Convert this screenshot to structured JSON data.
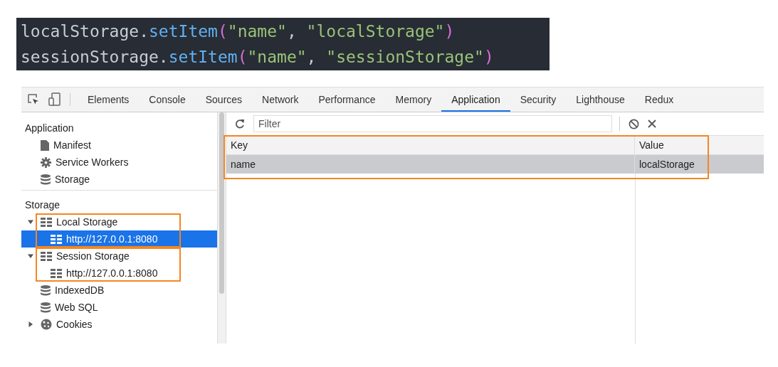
{
  "code_lines": [
    [
      {
        "kind": "plain",
        "text": "localStorage."
      },
      {
        "kind": "method",
        "text": "setItem"
      },
      {
        "kind": "paren",
        "text": "("
      },
      {
        "kind": "string",
        "text": "\"name\""
      },
      {
        "kind": "plain",
        "text": ", "
      },
      {
        "kind": "string",
        "text": "\"localStorage\""
      },
      {
        "kind": "paren",
        "text": ")"
      }
    ],
    [
      {
        "kind": "plain",
        "text": "sessionStorage."
      },
      {
        "kind": "method",
        "text": "setItem"
      },
      {
        "kind": "paren",
        "text": "("
      },
      {
        "kind": "string",
        "text": "\"name\""
      },
      {
        "kind": "plain",
        "text": ", "
      },
      {
        "kind": "string",
        "text": "\"sessionStorage\""
      },
      {
        "kind": "paren",
        "text": ")"
      }
    ]
  ],
  "tabs": [
    {
      "label": "Elements",
      "selected": false
    },
    {
      "label": "Console",
      "selected": false
    },
    {
      "label": "Sources",
      "selected": false
    },
    {
      "label": "Network",
      "selected": false
    },
    {
      "label": "Performance",
      "selected": false
    },
    {
      "label": "Memory",
      "selected": false
    },
    {
      "label": "Application",
      "selected": true
    },
    {
      "label": "Security",
      "selected": false
    },
    {
      "label": "Lighthouse",
      "selected": false
    },
    {
      "label": "Redux",
      "selected": false
    }
  ],
  "sidebar": {
    "sections": [
      {
        "title": "Application",
        "items": [
          {
            "label": "Manifest",
            "kind": "file"
          },
          {
            "label": "Service Workers",
            "kind": "gear"
          },
          {
            "label": "Storage",
            "kind": "database"
          }
        ]
      },
      {
        "title": "Storage",
        "items": [
          {
            "label": "Local Storage",
            "kind": "grid",
            "expanded": true,
            "highlighted": true,
            "children": [
              {
                "label": "http://127.0.0.1:8080",
                "kind": "grid",
                "selected": true
              }
            ]
          },
          {
            "label": "Session Storage",
            "kind": "grid",
            "expanded": true,
            "highlighted": true,
            "children": [
              {
                "label": "http://127.0.0.1:8080",
                "kind": "grid",
                "selected": false
              }
            ]
          },
          {
            "label": "IndexedDB",
            "kind": "database"
          },
          {
            "label": "Web SQL",
            "kind": "database"
          },
          {
            "label": "Cookies",
            "kind": "cookie",
            "expanded": false
          }
        ]
      }
    ]
  },
  "filter": {
    "placeholder": "Filter"
  },
  "table": {
    "highlighted": true,
    "columns": [
      "Key",
      "Value"
    ],
    "rows": [
      {
        "cells": [
          "name",
          "localStorage"
        ],
        "selected": true
      }
    ]
  }
}
